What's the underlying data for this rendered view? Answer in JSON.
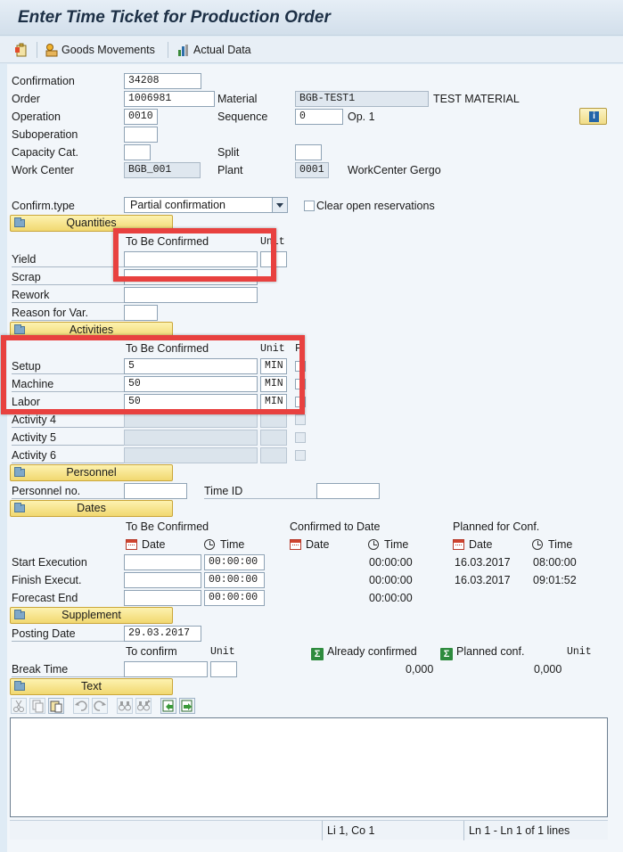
{
  "window": {
    "title": "Enter Time Ticket for Production Order"
  },
  "toolbar": {
    "goods_movements": "Goods Movements",
    "actual_data": "Actual Data"
  },
  "header": {
    "confirmation_label": "Confirmation",
    "confirmation_value": "34208",
    "order_label": "Order",
    "order_value": "1006981",
    "material_label": "Material",
    "material_value": "BGB-TEST1",
    "material_desc": "TEST MATERIAL",
    "operation_label": "Operation",
    "operation_value": "0010",
    "sequence_label": "Sequence",
    "sequence_value": "0",
    "op_text": "Op. 1",
    "suboperation_label": "Suboperation",
    "suboperation_value": "",
    "capacity_label": "Capacity Cat.",
    "capacity_value": "",
    "split_label": "Split",
    "split_value": "",
    "work_center_label": "Work Center",
    "work_center_value": "BGB_001",
    "plant_label": "Plant",
    "plant_value": "0001",
    "work_center_desc": "WorkCenter Gergo"
  },
  "confirm": {
    "type_label": "Confirm.type",
    "type_value": "Partial confirmation",
    "clear_label": "Clear open reservations",
    "clear_checked": false
  },
  "quantities": {
    "section": "Quantities",
    "col_tbc": "To Be Confirmed",
    "col_unit": "Unit",
    "rows": [
      {
        "label": "Yield",
        "value": "",
        "unit": ""
      },
      {
        "label": "Scrap",
        "value": ""
      },
      {
        "label": "Rework",
        "value": ""
      },
      {
        "label": "Reason for Var.",
        "value": ""
      }
    ]
  },
  "activities": {
    "section": "Activities",
    "col_tbc": "To Be Confirmed",
    "col_unit": "Unit",
    "col_extra": "F",
    "rows": [
      {
        "label": "Setup",
        "value": "5",
        "unit": "MIN"
      },
      {
        "label": "Machine",
        "value": "50",
        "unit": "MIN"
      },
      {
        "label": "Labor",
        "value": "50",
        "unit": "MIN"
      },
      {
        "label": "Activity 4",
        "value": "",
        "unit": ""
      },
      {
        "label": "Activity 5",
        "value": "",
        "unit": ""
      },
      {
        "label": "Activity 6",
        "value": "",
        "unit": ""
      }
    ]
  },
  "personnel": {
    "section": "Personnel",
    "personnel_label": "Personnel no.",
    "personnel_value": "",
    "time_id_label": "Time ID",
    "time_id_value": ""
  },
  "dates": {
    "section": "Dates",
    "col_tbc": "To Be Confirmed",
    "col_confirmed": "Confirmed to Date",
    "col_planned": "Planned for Conf.",
    "date_label": "Date",
    "time_label": "Time",
    "rows": [
      {
        "label": "Start Execution",
        "date": "",
        "time": "00:00:00",
        "conf_time": "00:00:00",
        "plan_date": "16.03.2017",
        "plan_time": "08:00:00"
      },
      {
        "label": "Finish Execut.",
        "date": "",
        "time": "00:00:00",
        "conf_time": "00:00:00",
        "plan_date": "16.03.2017",
        "plan_time": "09:01:52"
      },
      {
        "label": "Forecast End",
        "date": "",
        "time": "00:00:00",
        "conf_time": "00:00:00"
      }
    ]
  },
  "supplement": {
    "section": "Supplement",
    "posting_date_label": "Posting Date",
    "posting_date_value": "29.03.2017",
    "to_confirm_label": "To confirm",
    "unit_label": "Unit",
    "already_confirmed_label": "Already confirmed",
    "planned_conf_label": "Planned conf.",
    "unit_label_2": "Unit",
    "break_time_label": "Break Time",
    "break_value": "",
    "break_unit": "",
    "already_value": "0,000",
    "planned_value": "0,000"
  },
  "text": {
    "section": "Text",
    "content": ""
  },
  "statusbar": {
    "position": "Li 1, Co 1",
    "lines": "Ln 1 - Ln 1 of 1 lines"
  },
  "colors": {
    "highlight": "#e8413f",
    "section_tab": "#f1d870",
    "background": "#dfebf5"
  }
}
